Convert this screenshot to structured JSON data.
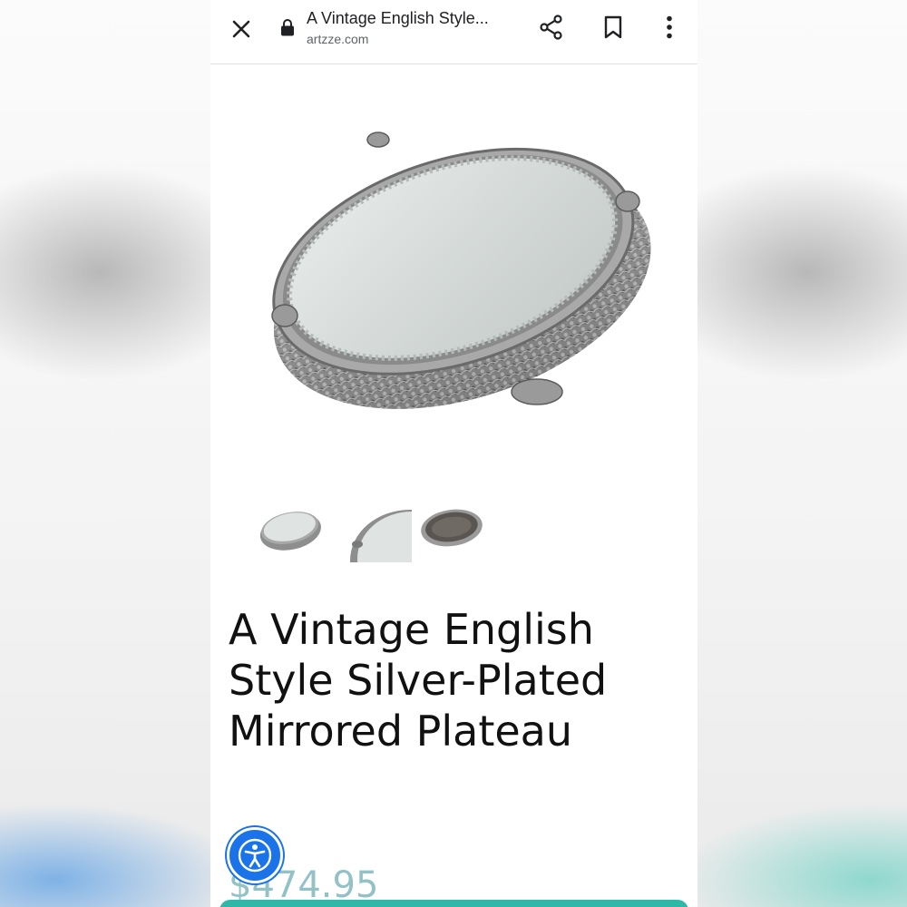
{
  "toolbar": {
    "page_title": "A Vintage English Style...",
    "url": "artzze.com",
    "icons": [
      "close-icon",
      "lock-icon",
      "share-icon",
      "bookmark-icon",
      "more-vert-icon"
    ]
  },
  "product": {
    "title": "A Vintage English Style Silver-Plated Mirrored Plateau",
    "price": "$474.95",
    "thumbnails": [
      "thumbnail-1",
      "thumbnail-2",
      "thumbnail-3"
    ]
  },
  "accessibility": {
    "icon": "accessibility-icon"
  },
  "colors": {
    "accessibility_blue": "#1a73e8",
    "price_teal": "#3a8f98",
    "bottom_bar_teal": "#2fb8a8"
  }
}
